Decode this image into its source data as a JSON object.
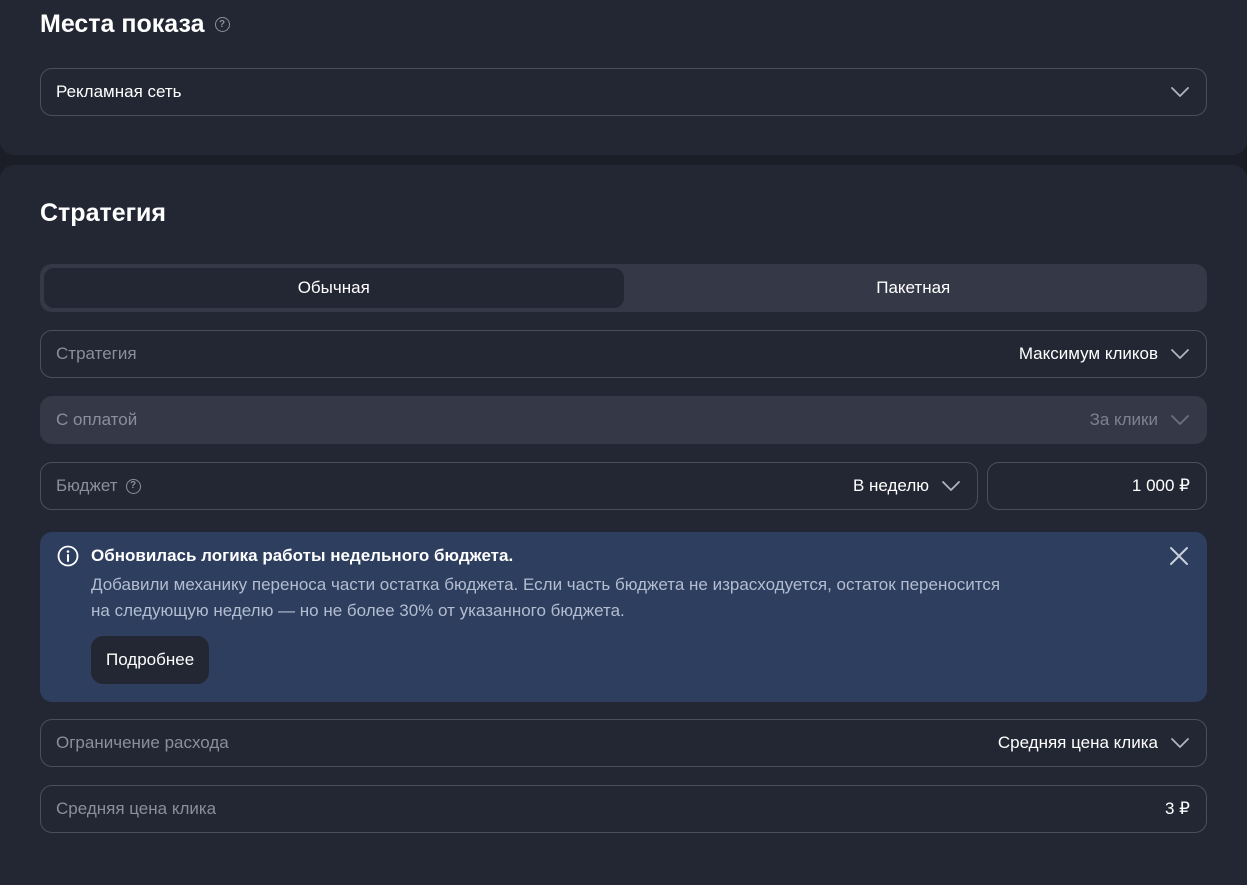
{
  "placements": {
    "title": "Места показа",
    "select_value": "Рекламная сеть"
  },
  "strategy_section": {
    "title": "Стратегия",
    "tabs": [
      {
        "label": "Обычная",
        "active": true
      },
      {
        "label": "Пакетная",
        "active": false
      }
    ],
    "strategy_field": {
      "label": "Стратегия",
      "value": "Максимум кликов"
    },
    "payment_field": {
      "label": "С оплатой",
      "value": "За клики",
      "disabled": true
    },
    "budget_field": {
      "label": "Бюджет",
      "period": "В неделю",
      "amount": "1 000 ₽"
    },
    "notice": {
      "title": "Обновилась логика работы недельного бюджета.",
      "body_line1": "Добавили механику переноса части остатка бюджета. Если часть бюджета не израсходуется, остаток переносится",
      "body_line2": "на следующую неделю — но не более 30% от указанного бюджета.",
      "button_label": "Подробнее"
    },
    "limit_field": {
      "label": "Ограничение расхода",
      "value": "Средняя цена клика"
    },
    "avg_cpc_field": {
      "label": "Средняя цена клика",
      "value": "3 ₽"
    }
  },
  "icons": {
    "help": "help-circle-icon",
    "chevron": "chevron-down-icon",
    "info": "info-circle-icon",
    "close": "close-icon"
  },
  "colors": {
    "background": "#1b1e26",
    "card": "#232733",
    "notice": "#2d3e5e",
    "border": "#4a4f5c",
    "muted_text": "#8a8f9c"
  }
}
